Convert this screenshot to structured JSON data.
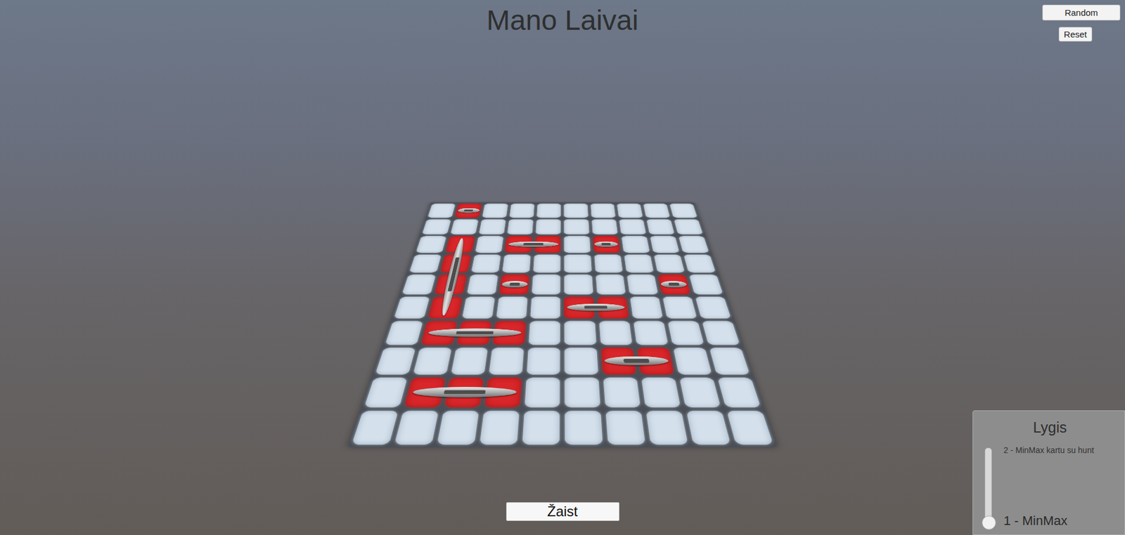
{
  "title": "Mano Laivai",
  "buttons": {
    "random": "Random",
    "reset": "Reset",
    "play": "Žaist"
  },
  "board": {
    "rows": [
      [
        false,
        true,
        false,
        false,
        false,
        false,
        false,
        false,
        false,
        false
      ],
      [
        false,
        false,
        false,
        false,
        false,
        false,
        false,
        false,
        false,
        false
      ],
      [
        false,
        true,
        false,
        true,
        true,
        false,
        true,
        false,
        false,
        false
      ],
      [
        false,
        true,
        false,
        false,
        false,
        false,
        false,
        false,
        false,
        false
      ],
      [
        false,
        true,
        false,
        true,
        false,
        false,
        false,
        false,
        true,
        false
      ],
      [
        false,
        true,
        false,
        false,
        false,
        true,
        true,
        false,
        false,
        false
      ],
      [
        false,
        true,
        true,
        true,
        false,
        false,
        false,
        false,
        false,
        false
      ],
      [
        false,
        false,
        false,
        false,
        false,
        false,
        true,
        true,
        false,
        false
      ],
      [
        false,
        true,
        true,
        true,
        false,
        false,
        false,
        false,
        false,
        false
      ],
      [
        false,
        false,
        false,
        false,
        false,
        false,
        false,
        false,
        false,
        false
      ]
    ]
  },
  "ships": [
    {
      "row": 0,
      "col": 1,
      "length": 1,
      "vertical": false
    },
    {
      "row": 2,
      "col": 1,
      "length": 4,
      "vertical": true
    },
    {
      "row": 2,
      "col": 3,
      "length": 2,
      "vertical": false
    },
    {
      "row": 2,
      "col": 6,
      "length": 1,
      "vertical": false
    },
    {
      "row": 4,
      "col": 3,
      "length": 1,
      "vertical": false
    },
    {
      "row": 4,
      "col": 8,
      "length": 1,
      "vertical": false
    },
    {
      "row": 5,
      "col": 5,
      "length": 2,
      "vertical": false
    },
    {
      "row": 6,
      "col": 1,
      "length": 3,
      "vertical": false
    },
    {
      "row": 7,
      "col": 6,
      "length": 2,
      "vertical": false
    },
    {
      "row": 8,
      "col": 1,
      "length": 3,
      "vertical": false
    }
  ],
  "difficulty": {
    "title": "Lygis",
    "max_label": "2 - MinMax kartu su hunt",
    "min_label": "1 - MinMax",
    "level": 0
  }
}
